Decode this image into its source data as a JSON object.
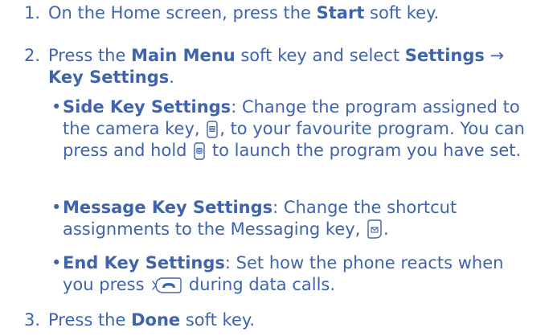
{
  "steps": [
    {
      "number": "1.",
      "pre": "On the Home screen, press the ",
      "bold": "Start",
      "post": " soft key."
    },
    {
      "number": "2.",
      "pre": "Press the ",
      "bold1": "Main Menu",
      "mid": " soft key and select ",
      "bold2": "Settings",
      "arrow": " →",
      "bold3": "Key Settings",
      "post": "."
    },
    {
      "number": "3.",
      "pre": "Press the ",
      "bold": "Done",
      "post": " soft key."
    }
  ],
  "bullets": [
    {
      "title": "Side Key Settings",
      "text1": ": Change the program assigned to the camera key, ",
      "text2": ", to your favourite program. You can press and hold ",
      "text3": " to launch the program you have set."
    },
    {
      "title": "Message Key Settings",
      "text1": ": Change the shortcut assignments to the Messaging key, ",
      "text2": "."
    },
    {
      "title": "End Key Settings",
      "text1": ": Set how the phone reacts when you press ",
      "text2": " during data calls."
    }
  ],
  "bullet_char": "•",
  "icons": {
    "camera_key": "camera-key-icon",
    "message_key": "message-key-icon",
    "end_key": "end-key-icon"
  },
  "colors": {
    "text": "#3f63ad"
  }
}
